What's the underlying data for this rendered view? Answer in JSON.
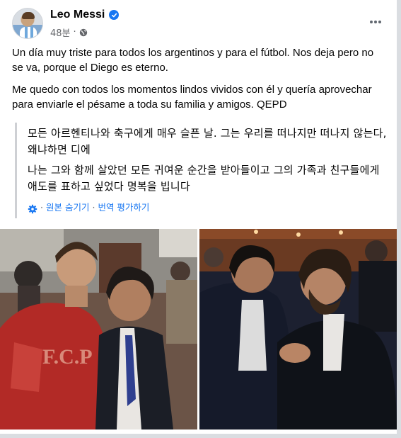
{
  "post": {
    "author": "Leo Messi",
    "time": "48분",
    "separator": "·",
    "paragraphs": [
      "Un día muy triste para todos los argentinos y para el fútbol. Nos deja pero no se va, porque el Diego es eterno.",
      "Me quedo con todos los momentos lindos vividos con él y quería aprovechar para enviarle el pésame a toda su familia y amigos. QEPD"
    ],
    "translation": {
      "paragraphs": [
        "모든 아르헨티나와 축구에게 매우 슬픈 날. 그는 우리를 떠나지만 떠나지 않는다, 왜냐하면 디에",
        "나는 그와 함께 살았던 모든 귀여운 순간을 받아들이고 그의 가족과 친구들에게 애도를 표하고 싶었다 명복을 빕니다"
      ],
      "hide_original": "원본 숨기기",
      "dot": "·",
      "rate_translation": "번역 평가하기"
    }
  },
  "icons": {
    "verified": "verified-badge-icon",
    "audience": "globe-icon",
    "more": "more-options-icon",
    "translation_settings": "gear-icon"
  },
  "colors": {
    "link": "#1877f2",
    "secondary_text": "#65676b",
    "verified": "#1877f2"
  }
}
